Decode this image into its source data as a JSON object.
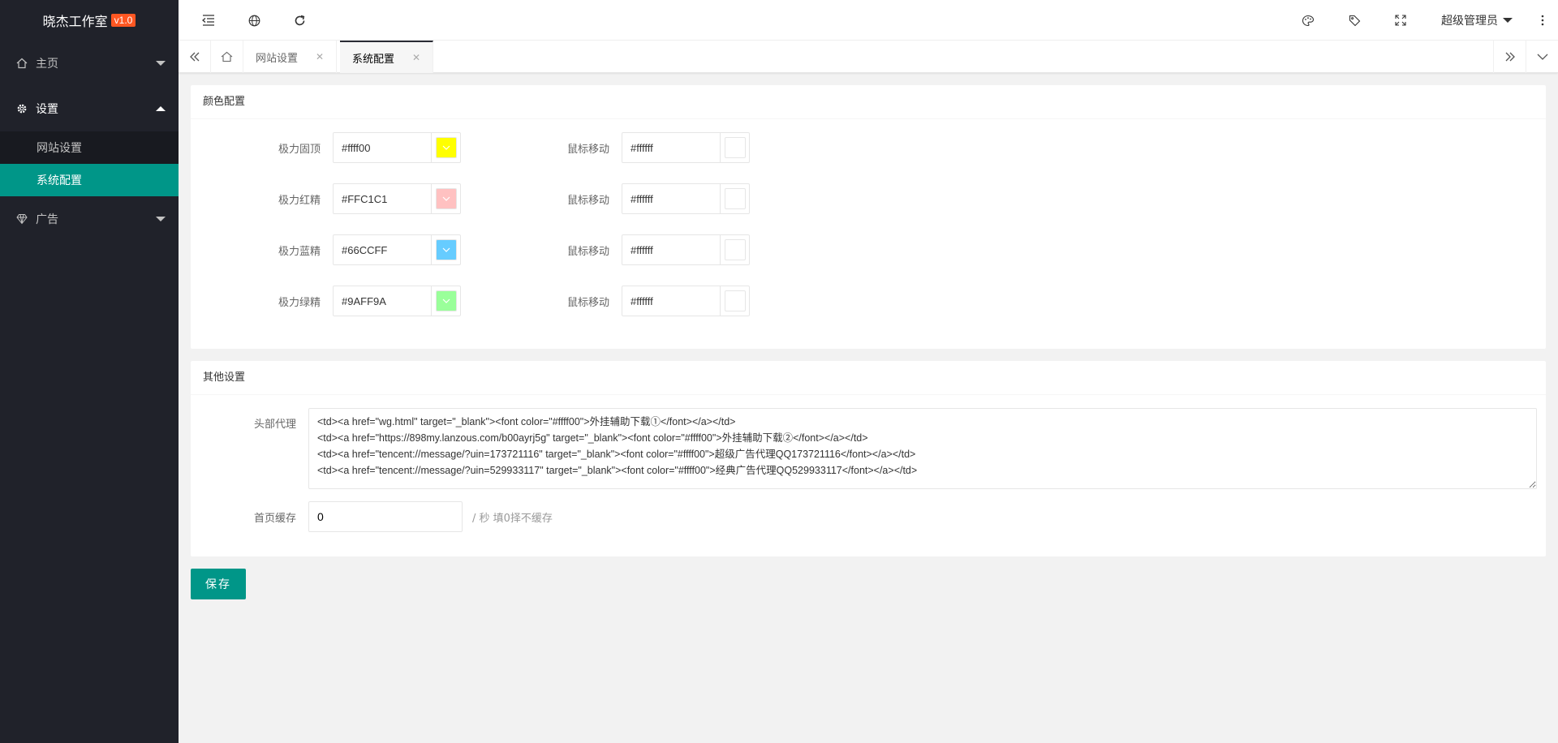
{
  "app": {
    "title": "晓杰工作室",
    "version": "v1.0"
  },
  "sidebar": {
    "items": [
      {
        "label": "主页"
      },
      {
        "label": "设置",
        "children": [
          {
            "label": "网站设置"
          },
          {
            "label": "系统配置"
          }
        ]
      },
      {
        "label": "广告"
      }
    ]
  },
  "header": {
    "user": "超级管理员"
  },
  "tabs": [
    {
      "label": "网站设置"
    },
    {
      "label": "系统配置"
    }
  ],
  "color_config": {
    "title": "颜色配置",
    "rows": [
      {
        "label": "极力固顶",
        "value": "#ffff00",
        "color": "#ffff00",
        "hover_label": "鼠标移动",
        "hover_value": "#ffffff"
      },
      {
        "label": "极力红精",
        "value": "#FFC1C1",
        "color": "#FFC1C1",
        "hover_label": "鼠标移动",
        "hover_value": "#ffffff"
      },
      {
        "label": "极力蓝精",
        "value": "#66CCFF",
        "color": "#66CCFF",
        "hover_label": "鼠标移动",
        "hover_value": "#ffffff"
      },
      {
        "label": "极力绿精",
        "value": "#9AFF9A",
        "color": "#9AFF9A",
        "hover_label": "鼠标移动",
        "hover_value": "#ffffff"
      }
    ]
  },
  "other_settings": {
    "title": "其他设置",
    "header_proxy_label": "头部代理",
    "header_proxy_value": "<td><a href=\"wg.html\" target=\"_blank\"><font color=\"#ffff00\">外挂辅助下载①</font></a></td>\n<td><a href=\"https://898my.lanzous.com/b00ayrj5g\" target=\"_blank\"><font color=\"#ffff00\">外挂辅助下载②</font></a></td>\n<td><a href=\"tencent://message/?uin=173721116\" target=\"_blank\"><font color=\"#ffff00\">超级广告代理QQ173721116</font></a></td>\n<td><a href=\"tencent://message/?uin=529933117\" target=\"_blank\"><font color=\"#ffff00\">经典广告代理QQ529933117</font></a></td>",
    "cache_label": "首页缓存",
    "cache_value": "0",
    "cache_hint": "/ 秒 填0择不缓存"
  },
  "save_label": "保存",
  "theme": {
    "accent": "#009688",
    "sidebar_bg": "#20222a",
    "version_badge": "#ff5722"
  }
}
